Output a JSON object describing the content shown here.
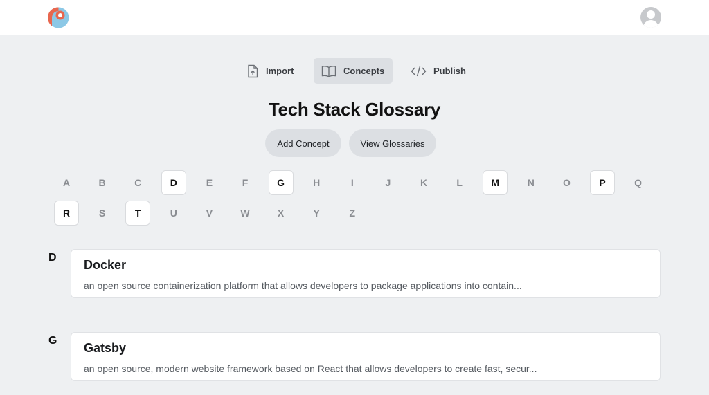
{
  "header": {
    "logo_icon": "app-logo-icon",
    "avatar_icon": "user-avatar-icon"
  },
  "tabs": [
    {
      "label": "Import",
      "icon": "file-upload-icon",
      "active": false
    },
    {
      "label": "Concepts",
      "icon": "open-book-icon",
      "active": true
    },
    {
      "label": "Publish",
      "icon": "code-icon",
      "active": false
    }
  ],
  "page": {
    "title": "Tech Stack Glossary",
    "add_concept_label": "Add Concept",
    "view_glossaries_label": "View Glossaries"
  },
  "alphabet": {
    "letters": [
      "A",
      "B",
      "C",
      "D",
      "E",
      "F",
      "G",
      "H",
      "I",
      "J",
      "K",
      "L",
      "M",
      "N",
      "O",
      "P",
      "Q",
      "R",
      "S",
      "T",
      "U",
      "V",
      "W",
      "X",
      "Y",
      "Z"
    ],
    "enabled": [
      "D",
      "G",
      "M",
      "P",
      "R",
      "T"
    ]
  },
  "sections": [
    {
      "letter": "D",
      "name": "Docker",
      "description": "an open source containerization platform that allows developers to package applications into contain..."
    },
    {
      "letter": "G",
      "name": "Gatsby",
      "description": "an open source, modern website framework based on React that allows developers to create fast, secur..."
    }
  ],
  "colors": {
    "background": "#eef0f2",
    "logo_red": "#e8674f",
    "logo_blue": "#8cc8e6"
  }
}
